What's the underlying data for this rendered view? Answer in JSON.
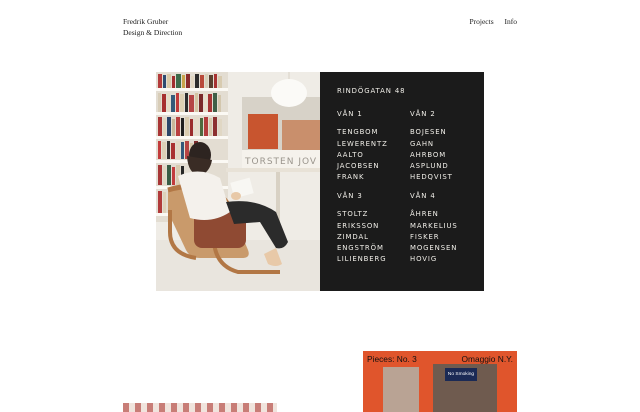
{
  "site": {
    "name": "Fredrik Gruber",
    "tagline": "Design & Direction"
  },
  "nav": {
    "projects": "Projects",
    "info": "Info"
  },
  "feature": {
    "illustration_sign": "TORSTEN JOV",
    "board": {
      "title": "RINDÖGATAN 48",
      "floors": [
        {
          "label": "VÅN 1",
          "names": [
            "TENGBOM",
            "LEWERENTZ",
            "AALTO",
            "JACOBSEN",
            "FRANK"
          ]
        },
        {
          "label": "VÅN 2",
          "names": [
            "BOJESEN",
            "GAHN",
            "AHRBOM",
            "ASPLUND",
            "HEDQVIST"
          ]
        },
        {
          "label": "VÅN 3",
          "names": [
            "STOLTZ",
            "ERIKSSON",
            "ZIMDAL",
            "ENGSTRÖM",
            "LILIENBERG"
          ]
        },
        {
          "label": "VÅN 4",
          "names": [
            "ÅHREN",
            "MARKELIUS",
            "FISKER",
            "MOGENSEN",
            "HOVIG"
          ]
        }
      ]
    }
  },
  "poster": {
    "left": "Pieces: No. 3",
    "right": "Omaggio N.Y.",
    "sign": "No Smoking"
  },
  "colors": {
    "board_bg": "#1b1b1b",
    "poster_bg": "#e0552c"
  }
}
